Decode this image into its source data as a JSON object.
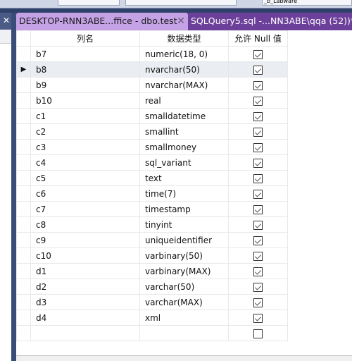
{
  "toolbar": {
    "database_value": "_b_Labware"
  },
  "left_panel": {
    "close_label": "✕"
  },
  "tabs": [
    {
      "label": "DESKTOP-RNN3ABE...ffice - dbo.test",
      "active": true,
      "close": "✕"
    },
    {
      "label": "SQLQuery5.sql -...NN3ABE\\qqa (52))*",
      "active": false
    }
  ],
  "grid": {
    "headers": {
      "name": "列名",
      "type": "数据类型",
      "nullable": "允许 Null 值"
    },
    "current_row_indicator": "▶",
    "rows": [
      {
        "name": "b7",
        "type": "numeric(18, 0)",
        "nullable": true
      },
      {
        "name": "b8",
        "type": "nvarchar(50)",
        "nullable": true,
        "selected": true
      },
      {
        "name": "b9",
        "type": "nvarchar(MAX)",
        "nullable": true
      },
      {
        "name": "b10",
        "type": "real",
        "nullable": true
      },
      {
        "name": "c1",
        "type": "smalldatetime",
        "nullable": true
      },
      {
        "name": "c2",
        "type": "smallint",
        "nullable": true
      },
      {
        "name": "c3",
        "type": "smallmoney",
        "nullable": true
      },
      {
        "name": "c4",
        "type": "sql_variant",
        "nullable": true
      },
      {
        "name": "c5",
        "type": "text",
        "nullable": true
      },
      {
        "name": "c6",
        "type": "time(7)",
        "nullable": true
      },
      {
        "name": "c7",
        "type": "timestamp",
        "nullable": true
      },
      {
        "name": "c8",
        "type": "tinyint",
        "nullable": true
      },
      {
        "name": "c9",
        "type": "uniqueidentifier",
        "nullable": true
      },
      {
        "name": "c10",
        "type": "varbinary(50)",
        "nullable": true
      },
      {
        "name": "d1",
        "type": "varbinary(MAX)",
        "nullable": true
      },
      {
        "name": "d2",
        "type": "varchar(50)",
        "nullable": true
      },
      {
        "name": "d3",
        "type": "varchar(MAX)",
        "nullable": true
      },
      {
        "name": "d4",
        "type": "xml",
        "nullable": true
      },
      {
        "name": "",
        "type": "",
        "nullable": false
      }
    ]
  }
}
